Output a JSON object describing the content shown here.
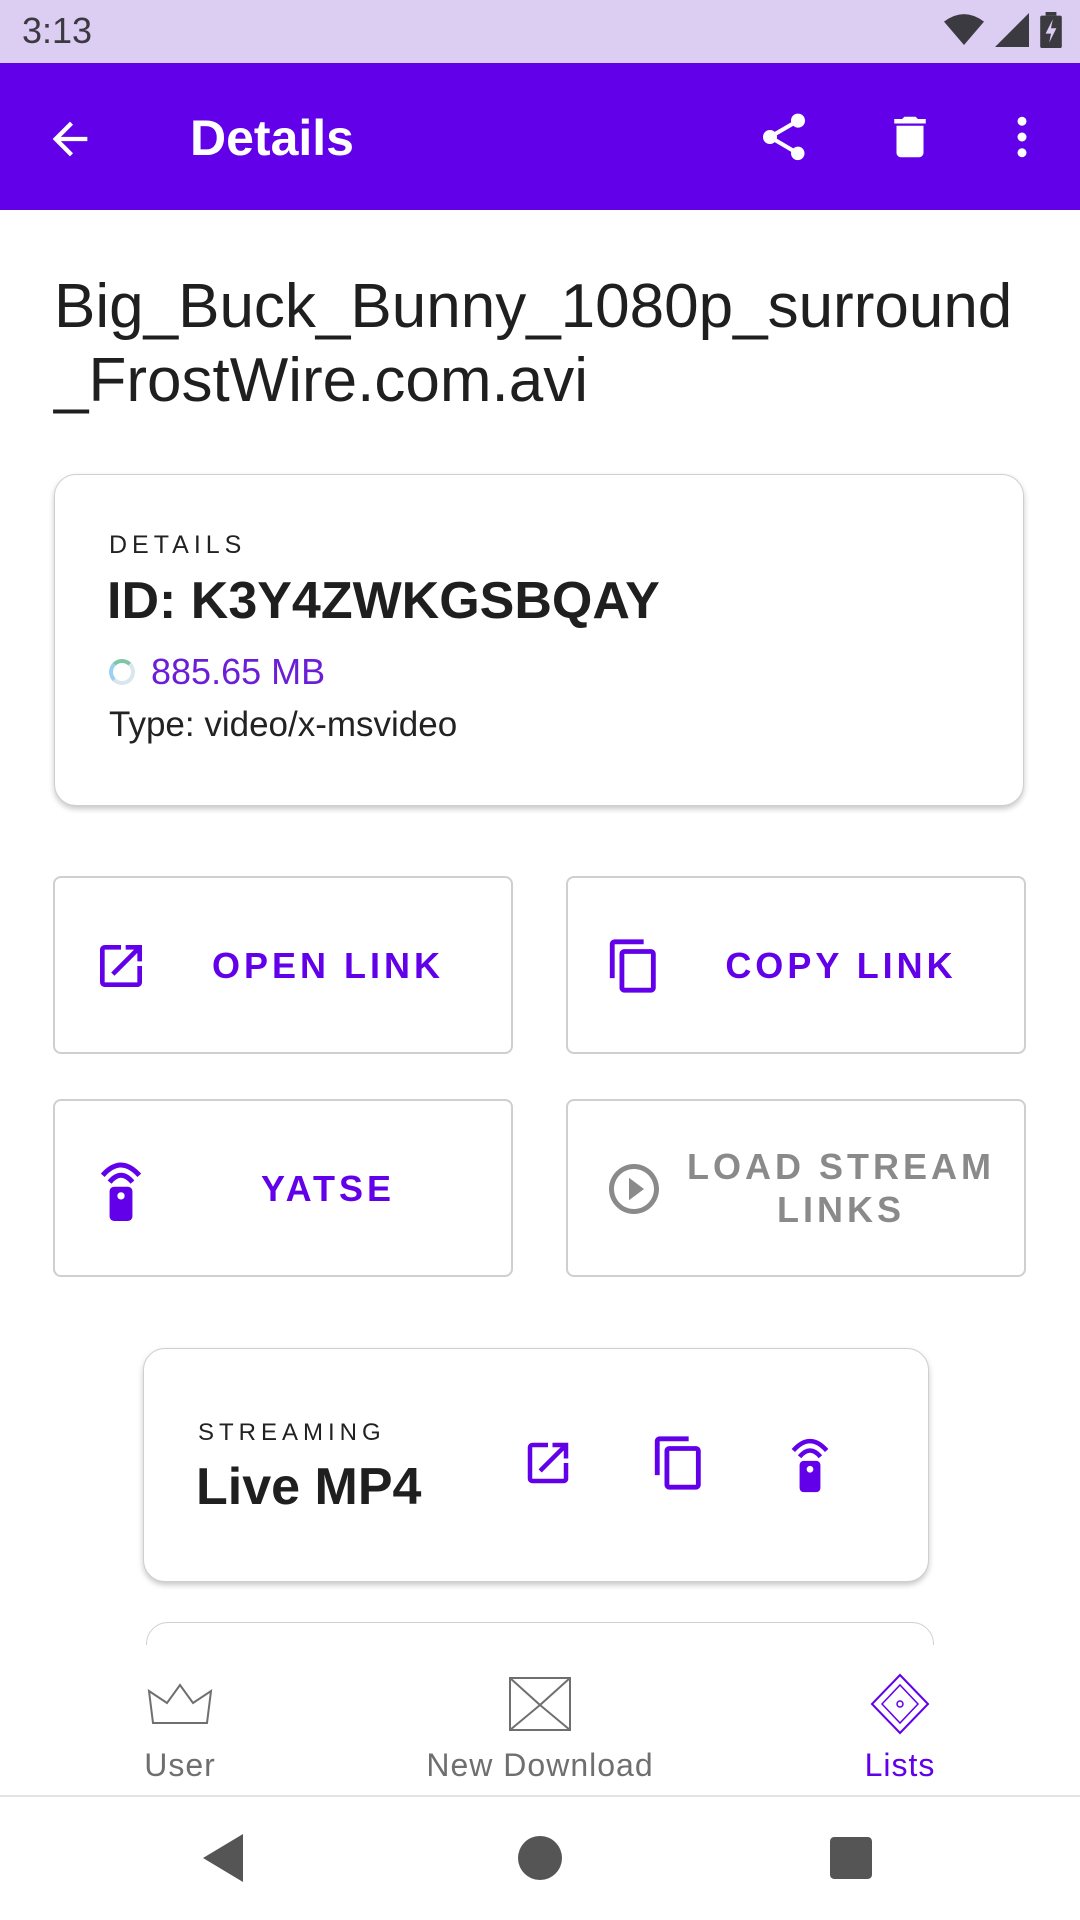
{
  "status_bar": {
    "time": "3:13",
    "icons": [
      "wifi-icon",
      "cellular-signal-icon",
      "battery-charging-icon"
    ]
  },
  "app_bar": {
    "title": "Details",
    "actions": [
      "back-arrow-icon",
      "share-icon",
      "delete-icon",
      "more-vert-icon"
    ]
  },
  "file": {
    "name": "Big_Buck_Bunny_1080p_surround_FrostWire.com.avi"
  },
  "details_card": {
    "overline": "DETAILS",
    "id": "ID: K3Y4ZWKGSBQAY",
    "size": "885.65 MB",
    "type": "Type: video/x-msvideo"
  },
  "actions": {
    "open_link": {
      "label": "OPEN LINK",
      "icon": "open-in-new-icon"
    },
    "copy_link": {
      "label": "COPY LINK",
      "icon": "copy-icon"
    },
    "yatse": {
      "label": "YATSE",
      "icon": "remote-icon"
    },
    "load_stream": {
      "label": "LOAD STREAM LINKS",
      "icon": "play-circle-icon",
      "enabled": false
    }
  },
  "streaming_card": {
    "overline": "STREAMING",
    "name": "Live MP4",
    "icons": [
      "open-in-new-icon",
      "copy-icon",
      "remote-icon"
    ]
  },
  "bottom_nav": {
    "items": [
      {
        "label": "User",
        "icon": "crown-icon",
        "active": false
      },
      {
        "label": "New Download",
        "icon": "envelope-icon",
        "active": false
      },
      {
        "label": "Lists",
        "icon": "diamond-icon",
        "active": true
      }
    ]
  },
  "colors": {
    "primary": "#6200ea",
    "status_bar": "#dccdf3",
    "inactive": "#6f6f6f",
    "disabled": "#8a8a8a"
  }
}
